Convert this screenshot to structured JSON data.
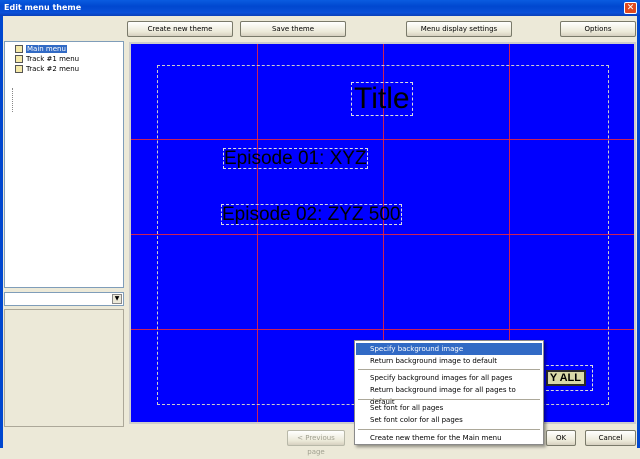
{
  "window": {
    "title": "Edit menu theme",
    "close_glyph": "✕"
  },
  "toolbar": {
    "create_new_theme": "Create new theme",
    "save_theme": "Save theme",
    "menu_display_settings": "Menu display settings",
    "options": "Options"
  },
  "tree": {
    "items": [
      {
        "label": "Main menu",
        "selected": true,
        "icon": "menu-page-icon"
      },
      {
        "label": "Track #1 menu",
        "selected": false,
        "icon": "menu-page-icon"
      },
      {
        "label": "Track #2 menu",
        "selected": false,
        "icon": "menu-page-icon"
      }
    ]
  },
  "combo": {
    "value": "",
    "arrow_glyph": "▼"
  },
  "preview": {
    "background_color": "#0000ff",
    "title_text": "Title",
    "episode1": "Episode 01:  XYZ",
    "episode2": "Episode 02:  ZYZ 500",
    "play_all_visible_text": "Y ALL"
  },
  "context_menu": {
    "items": [
      {
        "label": "Specify background image",
        "highlighted": true
      },
      {
        "label": "Return background image to default"
      },
      {
        "label": "Specify background images for all pages"
      },
      {
        "label": "Return background image for all pages to default"
      },
      {
        "label": "Set font for all pages"
      },
      {
        "label": "Set font color for all pages"
      },
      {
        "label": "Create new theme for the Main menu"
      }
    ]
  },
  "footer": {
    "previous_page": "< Previous page",
    "ok": "OK",
    "cancel": "Cancel"
  }
}
